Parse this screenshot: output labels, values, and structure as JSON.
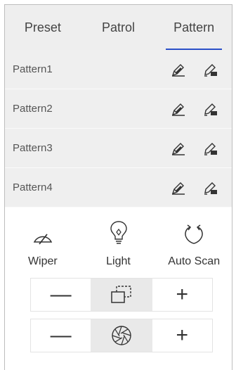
{
  "tabs": [
    {
      "label": "Preset",
      "active": false
    },
    {
      "label": "Patrol",
      "active": false
    },
    {
      "label": "Pattern",
      "active": true
    }
  ],
  "patterns": [
    {
      "label": "Pattern1"
    },
    {
      "label": "Pattern2"
    },
    {
      "label": "Pattern3"
    },
    {
      "label": "Pattern4"
    }
  ],
  "row_icons": {
    "first": "edit-pen-icon",
    "second": "edit-pencil-icon"
  },
  "features": [
    {
      "label": "Wiper",
      "icon": "wiper-icon"
    },
    {
      "label": "Light",
      "icon": "bulb-icon"
    },
    {
      "label": "Auto Scan",
      "icon": "auto-scan-icon"
    }
  ],
  "zoom": {
    "minus": "—",
    "plus": "+",
    "icon": "zoom-frame-icon"
  },
  "iris": {
    "minus": "—",
    "plus": "+",
    "icon": "iris-aperture-icon"
  },
  "colors": {
    "accent": "#2b50c8",
    "tab_bg": "#eeeeee",
    "row_bg": "#efefef"
  }
}
